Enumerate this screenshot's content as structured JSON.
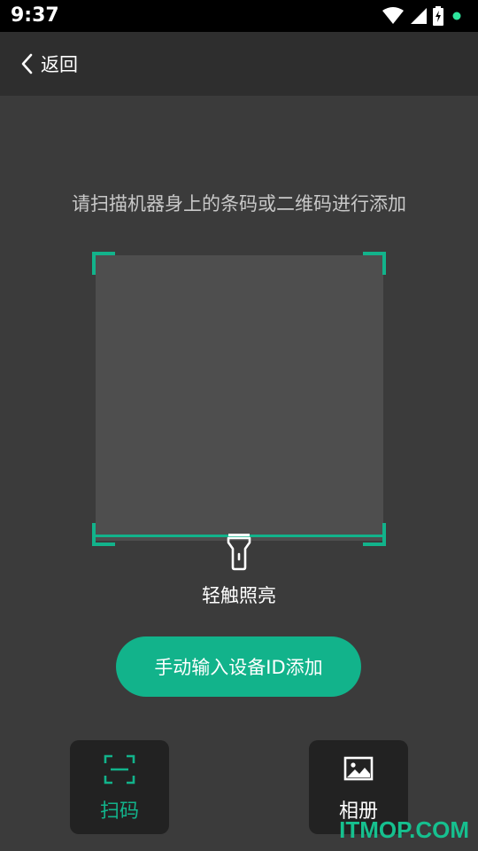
{
  "status_bar": {
    "time": "9:37",
    "icons": [
      "wifi-icon",
      "signal-icon",
      "battery-charging-icon",
      "notification-dot-icon"
    ]
  },
  "nav": {
    "back_label": "返回",
    "back_icon": "chevron-left-icon"
  },
  "scanner": {
    "instruction": "请扫描机器身上的条码或二维码进行添加",
    "flash_label": "轻触照亮",
    "flash_icon": "flashlight-icon"
  },
  "manual_button_label": "手动输入设备ID添加",
  "tabs": [
    {
      "label": "扫码",
      "icon": "scan-icon",
      "active": true
    },
    {
      "label": "相册",
      "icon": "image-icon",
      "active": false
    }
  ],
  "watermark": "ITMOP.COM",
  "colors": {
    "accent": "#12b38b",
    "background": "#3b3b3b",
    "nav_background": "#2e2e2e",
    "tab_background": "#222222"
  }
}
